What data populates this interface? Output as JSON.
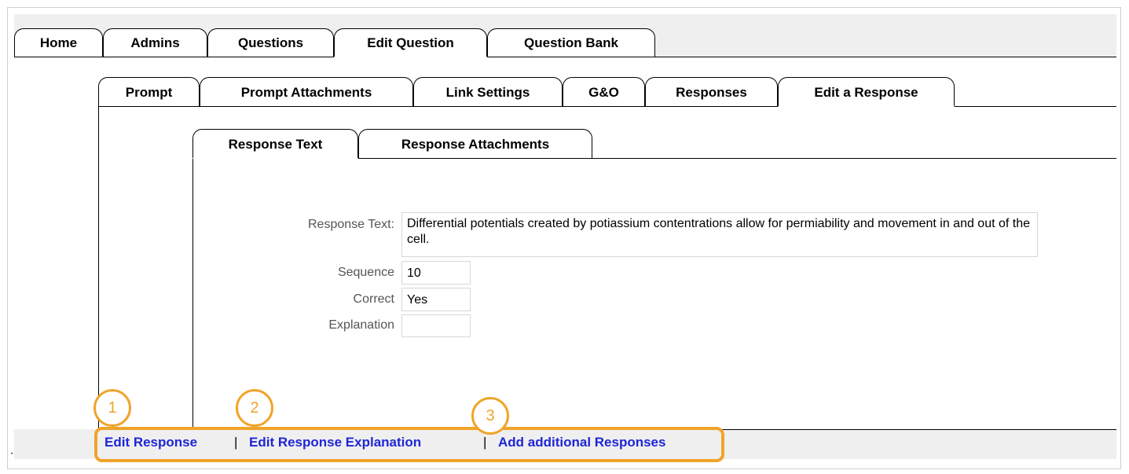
{
  "main_tabs": [
    {
      "label": "Home"
    },
    {
      "label": "Admins"
    },
    {
      "label": "Questions"
    },
    {
      "label": "Edit Question",
      "active": true
    },
    {
      "label": "Question Bank"
    }
  ],
  "question_tabs": [
    {
      "label": "Prompt"
    },
    {
      "label": "Prompt Attachments"
    },
    {
      "label": "Link Settings"
    },
    {
      "label": "G&O"
    },
    {
      "label": "Responses"
    },
    {
      "label": "Edit a Response",
      "active": true
    }
  ],
  "response_tabs": [
    {
      "label": "Response Text",
      "active": true
    },
    {
      "label": "Response Attachments"
    }
  ],
  "form": {
    "response_text_label": "Response Text:",
    "response_text_value": "Differential potentials created by potiassium contentrations allow for permiability and movement in and out of the cell.",
    "sequence_label": "Sequence",
    "sequence_value": "10",
    "correct_label": "Correct",
    "correct_value": "Yes",
    "explanation_label": "Explanation",
    "explanation_value": ""
  },
  "actions": {
    "edit_response": "Edit Response",
    "edit_response_explanation": "Edit Response Explanation",
    "add_additional_responses": "Add additional Responses",
    "separator": "|"
  },
  "callouts": [
    "1",
    "2",
    "3"
  ],
  "colors": {
    "link": "#1f26d6",
    "highlight": "#f0a42a",
    "background_gray": "#efefef"
  }
}
